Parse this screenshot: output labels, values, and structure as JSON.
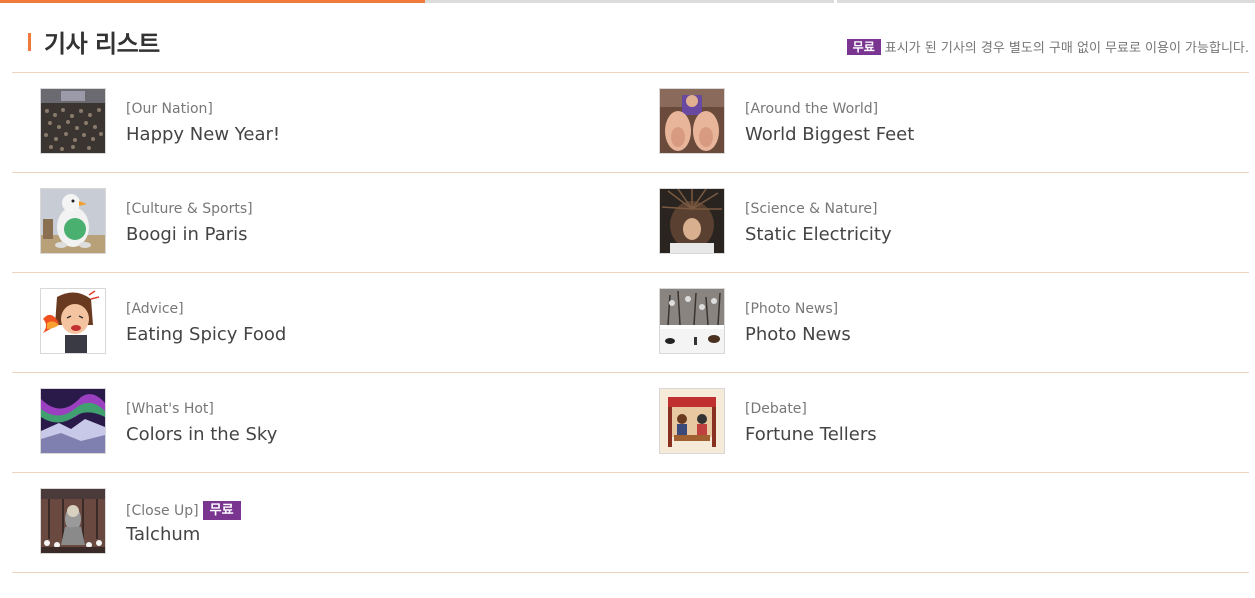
{
  "header": {
    "title": "기사 리스트",
    "free_badge": "무료",
    "notice": "표시가 된 기사의 경우 별도의 구매 없이 무료로 이용이 가능합니다."
  },
  "articles": [
    {
      "category": "[Our Nation]",
      "title": "Happy New Year!",
      "thumb": "crowd-photo"
    },
    {
      "category": "[Around the World]",
      "title": "World Biggest Feet",
      "thumb": "feet-photo"
    },
    {
      "category": "[Culture & Sports]",
      "title": "Boogi in Paris",
      "thumb": "mascot-photo"
    },
    {
      "category": "[Science & Nature]",
      "title": "Static Electricity",
      "thumb": "hair-photo"
    },
    {
      "category": "[Advice]",
      "title": "Eating Spicy Food",
      "thumb": "spicy-cartoon"
    },
    {
      "category": "[Photo News]",
      "title": "Photo News",
      "thumb": "snow-photo"
    },
    {
      "category": "[What's Hot]",
      "title": "Colors in the Sky",
      "thumb": "aurora-photo"
    },
    {
      "category": "[Debate]",
      "title": "Fortune Tellers",
      "thumb": "fortune-illustration"
    },
    {
      "category": "[Close Up]",
      "title": "Talchum",
      "thumb": "talchum-photo",
      "free": "무료"
    }
  ],
  "colors": {
    "accent": "#f07a3a",
    "badge": "#7a3591",
    "divider": "#f0d6c0"
  }
}
